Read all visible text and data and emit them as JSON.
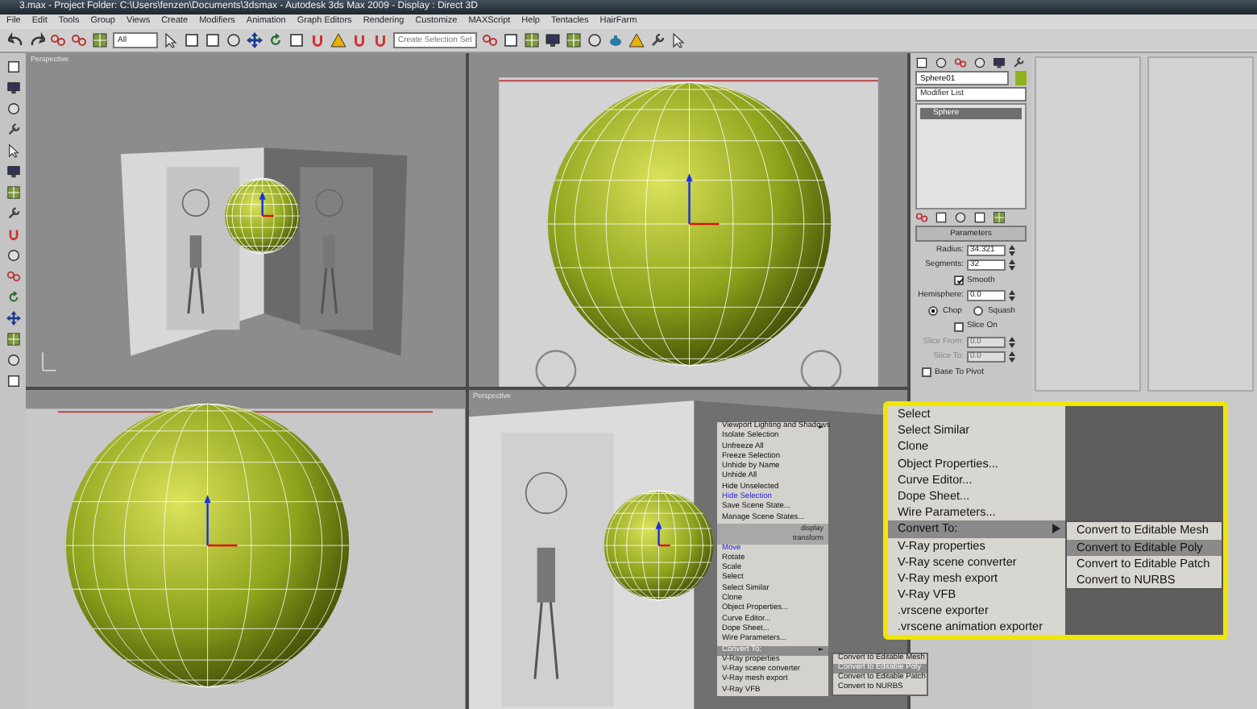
{
  "window": {
    "title": "3.max - Project Folder: C:\\Users\\fenzen\\Documents\\3dsmax - Autodesk 3ds Max 2009 - Display : Direct 3D"
  },
  "menu_bar": [
    "File",
    "Edit",
    "Tools",
    "Group",
    "Views",
    "Create",
    "Modifiers",
    "Animation",
    "Graph Editors",
    "Rendering",
    "Customize",
    "MAXScript",
    "Help",
    "Tentacles",
    "HairFarm"
  ],
  "toolbar": {
    "selection_filter": "All",
    "named_selection": {
      "placeholder": "Create Selection Set"
    }
  },
  "viewports": [
    {
      "label": "Perspective",
      "kind": "reference_planes"
    },
    {
      "kind": "sphere_front"
    },
    {
      "kind": "sphere_side"
    },
    {
      "label": "Perspective",
      "kind": "sphere_perspective"
    }
  ],
  "command_panel": {
    "object_name": "Sphere01",
    "modifier_list": "Modifier List",
    "stack": [
      {
        "label": "Sphere",
        "selected": true
      }
    ],
    "rollout_title": "Parameters",
    "params": [
      {
        "kind": "spinner",
        "label": "Radius:",
        "value": "34.321",
        "disabled": false
      },
      {
        "kind": "spinner",
        "label": "Segments:",
        "value": "32",
        "disabled": false
      },
      {
        "kind": "checkbox",
        "label": "Smooth",
        "checked": true
      },
      {
        "kind": "spinner",
        "label": "Hemisphere:",
        "value": "0.0",
        "disabled": false
      },
      {
        "kind": "radio_pair",
        "options": [
          {
            "label": "Chop",
            "selected": true
          },
          {
            "label": "Squash",
            "selected": false
          }
        ]
      },
      {
        "kind": "checkbox",
        "label": "Slice On",
        "checked": false
      },
      {
        "kind": "spinner",
        "label": "Slice From:",
        "value": "0.0",
        "disabled": true
      },
      {
        "kind": "spinner",
        "label": "Slice To:",
        "value": "0.0",
        "disabled": true
      },
      {
        "kind": "checkbox",
        "label": "Base To Pivot",
        "checked": false
      }
    ]
  },
  "quad_menu": {
    "items": [
      {
        "kind": "item",
        "label": "Viewport Lighting and Shadows",
        "emphasized": false,
        "selected": false,
        "submenu": true
      },
      {
        "kind": "item",
        "label": "Isolate Selection",
        "emphasized": false,
        "selected": false,
        "submenu": false
      },
      {
        "kind": "item",
        "label": "Unfreeze All",
        "emphasized": false,
        "selected": false,
        "submenu": false
      },
      {
        "kind": "item",
        "label": "Freeze Selection",
        "emphasized": false,
        "selected": false,
        "submenu": false
      },
      {
        "kind": "item",
        "label": "Unhide by Name",
        "emphasized": false,
        "selected": false,
        "submenu": false
      },
      {
        "kind": "item",
        "label": "Unhide All",
        "emphasized": false,
        "selected": false,
        "submenu": false
      },
      {
        "kind": "item",
        "label": "Hide Unselected",
        "emphasized": false,
        "selected": false,
        "submenu": false
      },
      {
        "kind": "item",
        "label": "Hide Selection",
        "emphasized": true,
        "selected": false,
        "submenu": false
      },
      {
        "kind": "item",
        "label": "Save Scene State...",
        "emphasized": false,
        "selected": false,
        "submenu": false
      },
      {
        "kind": "item",
        "label": "Manage Scene States...",
        "emphasized": false,
        "selected": false,
        "submenu": false
      },
      {
        "kind": "header",
        "label": "display"
      },
      {
        "kind": "header",
        "label": "transform"
      },
      {
        "kind": "item",
        "label": "Move",
        "emphasized": true,
        "selected": false,
        "submenu": false
      },
      {
        "kind": "item",
        "label": "Rotate",
        "emphasized": false,
        "selected": false,
        "submenu": false
      },
      {
        "kind": "item",
        "label": "Scale",
        "emphasized": false,
        "selected": false,
        "submenu": false
      },
      {
        "kind": "item",
        "label": "Select",
        "emphasized": false,
        "selected": false,
        "submenu": false
      },
      {
        "kind": "item",
        "label": "Select Similar",
        "emphasized": false,
        "selected": false,
        "submenu": false
      },
      {
        "kind": "item",
        "label": "Clone",
        "emphasized": false,
        "selected": false,
        "submenu": false
      },
      {
        "kind": "item",
        "label": "Object Properties...",
        "emphasized": false,
        "selected": false,
        "submenu": false
      },
      {
        "kind": "item",
        "label": "Curve Editor...",
        "emphasized": false,
        "selected": false,
        "submenu": false
      },
      {
        "kind": "item",
        "label": "Dope Sheet...",
        "emphasized": false,
        "selected": false,
        "submenu": false
      },
      {
        "kind": "item",
        "label": "Wire Parameters...",
        "emphasized": false,
        "selected": false,
        "submenu": false
      },
      {
        "kind": "item",
        "label": "Convert To:",
        "emphasized": false,
        "selected": true,
        "submenu": true
      },
      {
        "kind": "item",
        "label": "V-Ray properties",
        "emphasized": false,
        "selected": false,
        "submenu": false
      },
      {
        "kind": "item",
        "label": "V-Ray scene converter",
        "emphasized": false,
        "selected": false,
        "submenu": false
      },
      {
        "kind": "item",
        "label": "V-Ray mesh export",
        "emphasized": false,
        "selected": false,
        "submenu": false
      },
      {
        "kind": "item",
        "label": "V-Ray VFB",
        "emphasized": false,
        "selected": false,
        "submenu": false
      }
    ],
    "submenu": [
      {
        "label": "Convert to Editable Mesh",
        "selected": false
      },
      {
        "label": "Convert to Editable Poly",
        "selected": true
      },
      {
        "label": "Convert to Editable Patch",
        "selected": false
      },
      {
        "label": "Convert to NURBS",
        "selected": false
      }
    ]
  },
  "zoom_callout": {
    "items": [
      {
        "label": "Select",
        "selected": false,
        "submenu": false
      },
      {
        "label": "Select Similar",
        "selected": false,
        "submenu": false
      },
      {
        "label": "Clone",
        "selected": false,
        "submenu": false
      },
      {
        "label": "Object Properties...",
        "selected": false,
        "submenu": false
      },
      {
        "label": "Curve Editor...",
        "selected": false,
        "submenu": false
      },
      {
        "label": "Dope Sheet...",
        "selected": false,
        "submenu": false
      },
      {
        "label": "Wire Parameters...",
        "selected": false,
        "submenu": false
      },
      {
        "label": "Convert To:",
        "selected": true,
        "submenu": true
      },
      {
        "label": "V-Ray properties",
        "selected": false,
        "submenu": false
      },
      {
        "label": "V-Ray scene converter",
        "selected": false,
        "submenu": false
      },
      {
        "label": "V-Ray mesh export",
        "selected": false,
        "submenu": false
      },
      {
        "label": "V-Ray VFB",
        "selected": false,
        "submenu": false
      },
      {
        "label": ".vrscene exporter",
        "selected": false,
        "submenu": false
      },
      {
        "label": ".vrscene animation exporter",
        "selected": false,
        "submenu": false
      }
    ],
    "submenu": [
      {
        "label": "Convert to Editable Mesh",
        "selected": false
      },
      {
        "label": "Convert to Editable Poly",
        "selected": true
      },
      {
        "label": "Convert to Editable Patch",
        "selected": false
      },
      {
        "label": "Convert to NURBS",
        "selected": false
      }
    ]
  }
}
